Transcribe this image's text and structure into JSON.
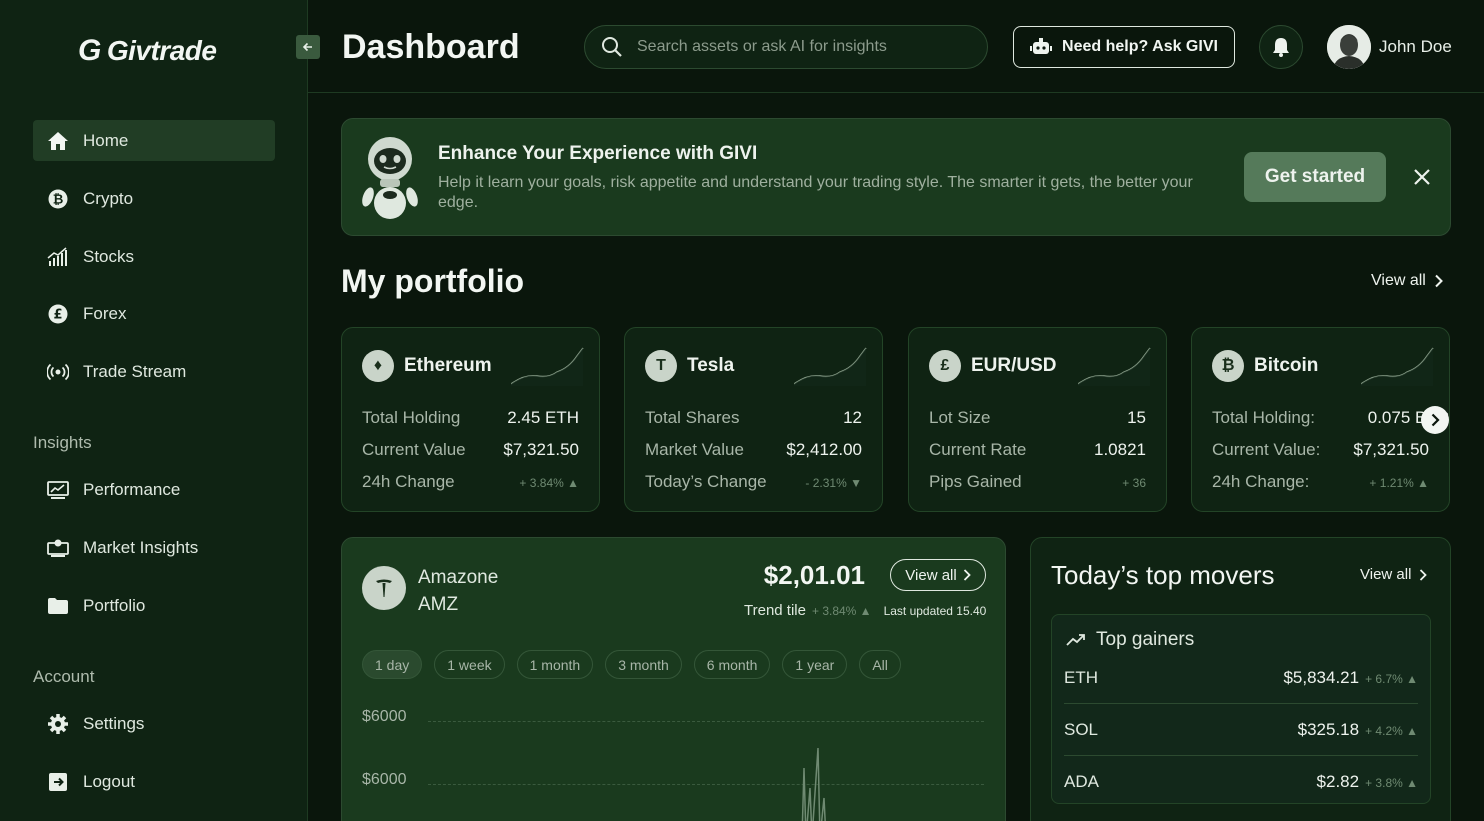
{
  "brand": {
    "logo_text": "Givtrade",
    "logo_glyph": "G"
  },
  "sidebar": {
    "items": [
      {
        "label": "Home",
        "icon": "home-icon"
      },
      {
        "label": "Crypto",
        "icon": "bitcoin-icon"
      },
      {
        "label": "Stocks",
        "icon": "bar-chart-icon"
      },
      {
        "label": "Forex",
        "icon": "pound-icon"
      },
      {
        "label": "Trade Stream",
        "icon": "broadcast-icon"
      }
    ],
    "insights_label": "Insights",
    "insights_items": [
      {
        "label": "Performance",
        "icon": "monitor-chart-icon"
      },
      {
        "label": "Market Insights",
        "icon": "presentation-icon"
      },
      {
        "label": "Portfolio",
        "icon": "folder-icon"
      }
    ],
    "account_label": "Account",
    "account_items": [
      {
        "label": "Settings",
        "icon": "gear-icon"
      },
      {
        "label": "Logout",
        "icon": "logout-icon"
      }
    ]
  },
  "header": {
    "title": "Dashboard",
    "search_placeholder": "Search assets or ask AI for insights",
    "ask_label": "Need help? Ask GIVI",
    "user_name": "John Doe"
  },
  "banner": {
    "title": "Enhance Your Experience with GIVI",
    "text": "Help it learn your goals, risk appetite and understand your trading style. The smarter it gets, the better your edge.",
    "cta": "Get started"
  },
  "portfolio": {
    "title": "My portfolio",
    "view_all": "View all",
    "cards": [
      {
        "name": "Ethereum",
        "coin": "♦",
        "rows": [
          {
            "label": "Total Holding",
            "value": "2.45 ETH"
          },
          {
            "label": "Current Value",
            "value": "$7,321.50"
          },
          {
            "label": "24h Change",
            "value": "+ 3.84% ▲"
          }
        ]
      },
      {
        "name": "Tesla",
        "coin": "T",
        "rows": [
          {
            "label": "Total Shares",
            "value": "12"
          },
          {
            "label": "Market Value",
            "value": "$2,412.00"
          },
          {
            "label": "Today’s Change",
            "value": "- 2.31% ▼"
          }
        ]
      },
      {
        "name": "EUR/USD",
        "coin": "£",
        "rows": [
          {
            "label": "Lot Size",
            "value": "15"
          },
          {
            "label": "Current Rate",
            "value": "1.0821"
          },
          {
            "label": "Pips Gained",
            "value": "+ 36"
          }
        ]
      },
      {
        "name": "Bitcoin",
        "coin": "₿",
        "rows": [
          {
            "label": "Total Holding:",
            "value": "0.075 BTC"
          },
          {
            "label": "Current Value:",
            "value": "$7,321.50"
          },
          {
            "label": "24h Change:",
            "value": "+ 1.21% ▲"
          }
        ]
      }
    ]
  },
  "asset": {
    "name": "Amazone",
    "ticker": "AMZ",
    "price": "$2,01.01",
    "view_all": "View all",
    "trend_label": "Trend tile",
    "trend_change": "+ 3.84% ▲",
    "last_updated": "Last updated 15.40",
    "ranges": [
      "1 day",
      "1 week",
      "1 month",
      "3 month",
      "6 month",
      "1 year",
      "All"
    ],
    "active_range": "1 day",
    "y_ticks": [
      "$6000",
      "$6000"
    ]
  },
  "movers": {
    "title": "Today’s top movers",
    "view_all": "View all",
    "gainers_label": "Top gainers",
    "rows": [
      {
        "symbol": "ETH",
        "price": "$5,834.21",
        "change": "+ 6.7% ▲"
      },
      {
        "symbol": "SOL",
        "price": "$325.18",
        "change": "+ 4.2% ▲"
      },
      {
        "symbol": "ADA",
        "price": "$2.82",
        "change": "+ 3.8% ▲"
      }
    ]
  }
}
